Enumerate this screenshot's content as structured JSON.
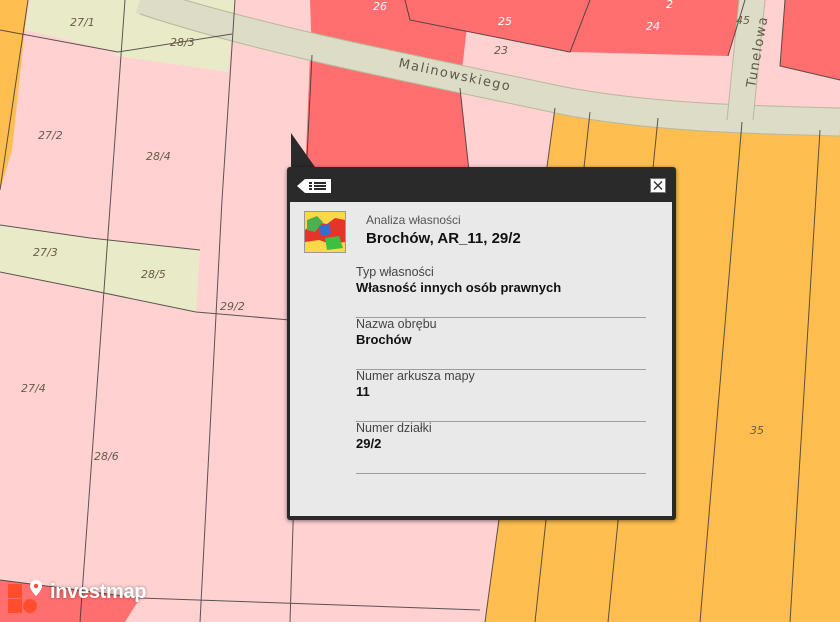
{
  "map": {
    "street_labels": [
      "Malinowskiego",
      "Tunelowa"
    ],
    "parcels": [
      "27/1",
      "28/3",
      "27/2",
      "28/4",
      "27/3",
      "28/5",
      "29/2",
      "27/4",
      "28/6",
      "35",
      "26",
      "25",
      "24",
      "23",
      "45",
      "2"
    ]
  },
  "popup": {
    "subtitle": "Analiza własności",
    "title": "Brochów, AR_11, 29/2",
    "fields": [
      {
        "label": "Typ własności",
        "value": "Własność innych osób prawnych"
      },
      {
        "label": "Nazwa obrębu",
        "value": "Brochów"
      },
      {
        "label": "Numer arkusza mapy",
        "value": "11"
      },
      {
        "label": "Numer działki",
        "value": "29/2"
      }
    ]
  },
  "logo": {
    "text": "investmap"
  },
  "colors": {
    "pink": "#ffd1d1",
    "green": "#e9ebc8",
    "red": "#ff6f6f",
    "orange": "#ffbe4f",
    "road": "#dcdcc7",
    "popup_frame": "#2a2a2a",
    "popup_body": "#e9e9e9",
    "logo_accent": "#ff4d2e"
  }
}
